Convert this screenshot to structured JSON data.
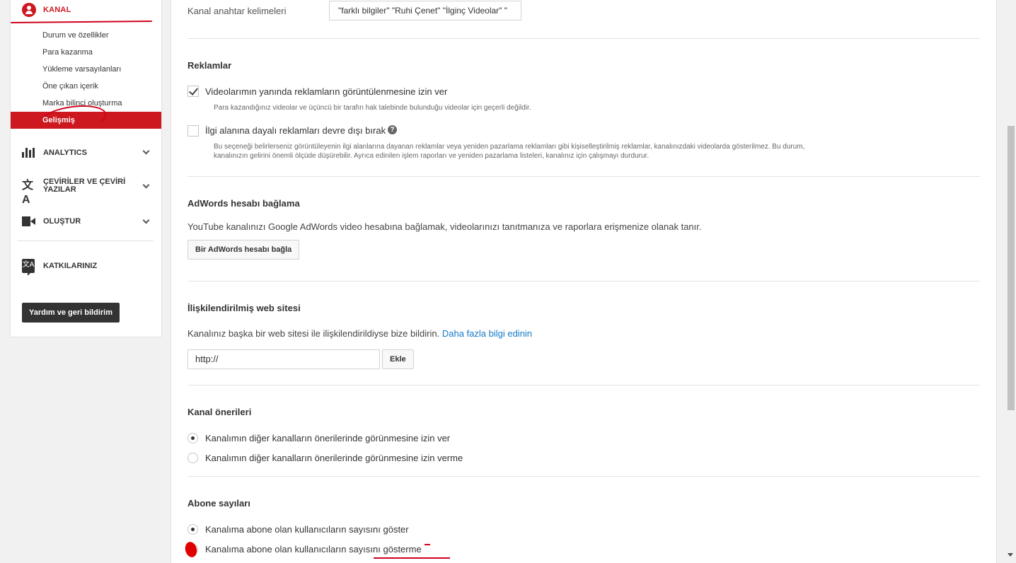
{
  "sidebar": {
    "top_label": "KANAL",
    "sub_items": [
      {
        "label": "Durum ve özellikler"
      },
      {
        "label": "Para kazanma"
      },
      {
        "label": "Yükleme varsayılanları"
      },
      {
        "label": "Öne çıkan içerik"
      },
      {
        "label": "Marka bilinci oluşturma"
      },
      {
        "label": "Gelişmiş"
      }
    ],
    "sections": [
      {
        "label": "ANALYTICS"
      },
      {
        "label": "ÇEVİRİLER VE ÇEVİRİ YAZILAR"
      },
      {
        "label": "OLUŞTUR"
      }
    ],
    "contrib_label": "KATKILARINIZ",
    "translate_glyph": "文A",
    "contrib_glyph": "文A",
    "help_button": "Yardım ve geri bildirim",
    "accent_color": "#cc181e"
  },
  "main": {
    "keywords": {
      "label": "Kanal anahtar kelimeleri",
      "value": "\"farklı bilgiler\" \"Ruhi Çenet\" \"İlginç Videolar\" \""
    },
    "ads": {
      "title": "Reklamlar",
      "option1_label": "Videolarımın yanında reklamların görüntülenmesine izin ver",
      "option1_desc": "Para kazandığınız videolar ve üçüncü bir tarafın hak talebinde bulunduğu videolar için geçerli değildir.",
      "option1_checked": true,
      "option2_label": "İlgi alanına dayalı reklamları devre dışı bırak",
      "option2_desc_line1": "Bu seçeneği belirlerseniz görüntüleyenin ilgi alanlarına dayanan reklamlar veya yeniden pazarlama reklamları gibi kişiselleştirilmiş reklamlar, kanalınızdaki videolarda gösterilmez. Bu durum,",
      "option2_desc_line2": "kanalınızın gelirini önemli ölçüde düşürebilir. Ayrıca edinilen işlem raporları ve yeniden pazarlama listeleri, kanalınız için çalışmayı durdurur.",
      "option2_checked": false,
      "help_glyph": "?"
    },
    "adwords": {
      "title": "AdWords hesabı bağlama",
      "desc": "YouTube kanalınızı Google AdWords video hesabına bağlamak, videolarınızı tanıtmanıza ve raporlara erişmenize olanak tanır.",
      "button": "Bir AdWords hesabı bağla"
    },
    "website": {
      "title": "İlişkilendirilmiş web sitesi",
      "desc": "Kanalınız başka bir web sitesi ile ilişkilendirildiyse bize bildirin.",
      "link": "Daha fazla bilgi edinin",
      "input_value": "http://",
      "add_button": "Ekle"
    },
    "recommendations": {
      "title": "Kanal önerileri",
      "option1": "Kanalımın diğer kanalların önerilerinde görünmesine izin ver",
      "option2": "Kanalımın diğer kanalların önerilerinde görünmesine izin verme",
      "selected": 1
    },
    "subscribers": {
      "title": "Abone sayıları",
      "option1": "Kanalıma abone olan kullanıcıların sayısını göster",
      "option2": "Kanalıma abone olan kullanıcıların sayısını gösterme",
      "selected": 1
    }
  }
}
